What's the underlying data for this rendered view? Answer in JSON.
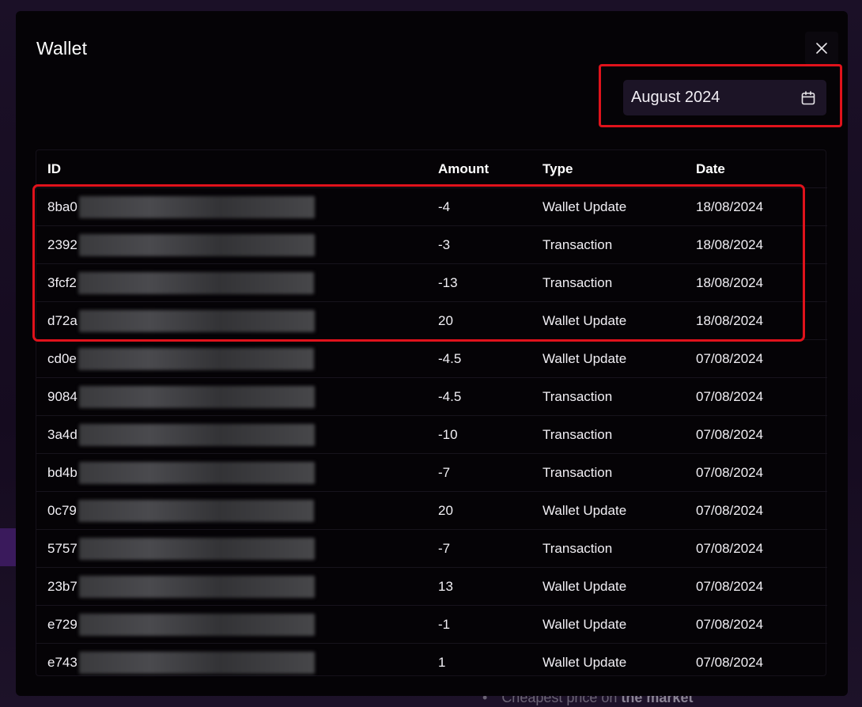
{
  "backdrop": {
    "footnote_prefix": "Cheapest price on ",
    "footnote_bold": "the market"
  },
  "modal": {
    "title": "Wallet",
    "close_icon": "close-icon"
  },
  "date_filter": {
    "value": "August 2024",
    "icon": "calendar-icon"
  },
  "table": {
    "headers": [
      "ID",
      "Amount",
      "Type",
      "Date"
    ],
    "rows": [
      {
        "id_prefix": "8ba0",
        "amount": "-4",
        "type": "Wallet Update",
        "date": "18/08/2024"
      },
      {
        "id_prefix": "2392",
        "amount": "-3",
        "type": "Transaction",
        "date": "18/08/2024"
      },
      {
        "id_prefix": "3fcf2",
        "amount": "-13",
        "type": "Transaction",
        "date": "18/08/2024"
      },
      {
        "id_prefix": "d72a",
        "amount": "20",
        "type": "Wallet Update",
        "date": "18/08/2024"
      },
      {
        "id_prefix": "cd0e",
        "amount": "-4.5",
        "type": "Wallet Update",
        "date": "07/08/2024"
      },
      {
        "id_prefix": "9084",
        "amount": "-4.5",
        "type": "Transaction",
        "date": "07/08/2024"
      },
      {
        "id_prefix": "3a4d",
        "amount": "-10",
        "type": "Transaction",
        "date": "07/08/2024"
      },
      {
        "id_prefix": "bd4b",
        "amount": "-7",
        "type": "Transaction",
        "date": "07/08/2024"
      },
      {
        "id_prefix": "0c79",
        "amount": "20",
        "type": "Wallet Update",
        "date": "07/08/2024"
      },
      {
        "id_prefix": "5757",
        "amount": "-7",
        "type": "Transaction",
        "date": "07/08/2024"
      },
      {
        "id_prefix": "23b7",
        "amount": "13",
        "type": "Wallet Update",
        "date": "07/08/2024"
      },
      {
        "id_prefix": "e729",
        "amount": "-1",
        "type": "Wallet Update",
        "date": "07/08/2024"
      },
      {
        "id_prefix": "e743",
        "amount": "1",
        "type": "Wallet Update",
        "date": "07/08/2024"
      }
    ]
  },
  "colors": {
    "highlight": "#e0121b",
    "modal_bg": "#050306",
    "date_picker_bg": "#1c1426"
  }
}
